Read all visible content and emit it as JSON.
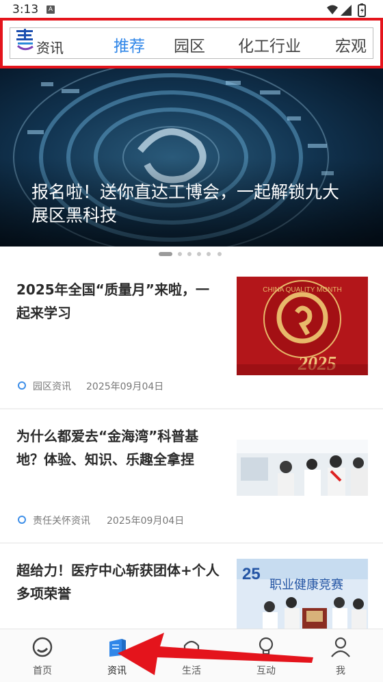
{
  "status": {
    "time": "3:13",
    "notif_badge": "A"
  },
  "header": {
    "logo_text": "资讯",
    "tabs": [
      {
        "label": "推荐",
        "active": true
      },
      {
        "label": "园区",
        "active": false
      },
      {
        "label": "化工行业",
        "active": false
      },
      {
        "label": "宏观",
        "active": false
      }
    ]
  },
  "banner": {
    "title": "报名啦！送你直达工博会，一起解锁九大展区黑科技",
    "page_count": 6,
    "current_page": 1
  },
  "news": [
    {
      "title": "2025年全国“质量月”来啦，一起来学习",
      "category": "园区资讯",
      "date": "2025年09月04日",
      "thumb_caption": "CHINA QUALITY MONTH",
      "thumb_year": "2025"
    },
    {
      "title": "为什么都爱去“金海湾”科普基地？体验、知识、乐趣全拿捏",
      "category": "责任关怀资讯",
      "date": "2025年09月04日"
    },
    {
      "title": "超给力！医疗中心斩获团体+个人多项荣誉",
      "thumb_caption": "职业健康竞赛"
    }
  ],
  "bottom_nav": [
    {
      "label": "首页",
      "icon": "home-ring-icon",
      "active": false
    },
    {
      "label": "资讯",
      "icon": "news-book-icon",
      "active": true
    },
    {
      "label": "生活",
      "icon": "life-icon",
      "active": false
    },
    {
      "label": "互动",
      "icon": "bulb-icon",
      "active": false
    },
    {
      "label": "我",
      "icon": "user-icon",
      "active": false
    }
  ],
  "colors": {
    "accent": "#2f86e8",
    "highlight_border": "#e4141c",
    "annotation_arrow": "#e4141c"
  }
}
